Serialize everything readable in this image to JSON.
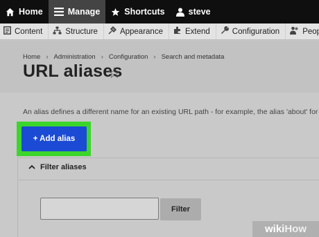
{
  "toolbar": {
    "home": "Home",
    "manage": "Manage",
    "shortcuts": "Shortcuts",
    "user": "steve"
  },
  "admin_menu": [
    {
      "label": "Content",
      "icon": "content-icon"
    },
    {
      "label": "Structure",
      "icon": "structure-icon"
    },
    {
      "label": "Appearance",
      "icon": "appearance-icon"
    },
    {
      "label": "Extend",
      "icon": "extend-icon"
    },
    {
      "label": "Configuration",
      "icon": "wrench-icon"
    },
    {
      "label": "People",
      "icon": "people-icon"
    }
  ],
  "breadcrumb": [
    "Home",
    "Administration",
    "Configuration",
    "Search and metadata"
  ],
  "page": {
    "title": "URL aliases",
    "description": "An alias defines a different name for an existing URL path - for example, the alias 'about' for"
  },
  "actions": {
    "add_alias": "+ Add alias"
  },
  "filter": {
    "heading": "Filter aliases",
    "input_value": "",
    "button": "Filter"
  },
  "watermark": {
    "prefix": "wiki",
    "suffix": "How"
  },
  "colors": {
    "accent_button": "#1b4bd4",
    "highlight": "#3cd52b"
  }
}
